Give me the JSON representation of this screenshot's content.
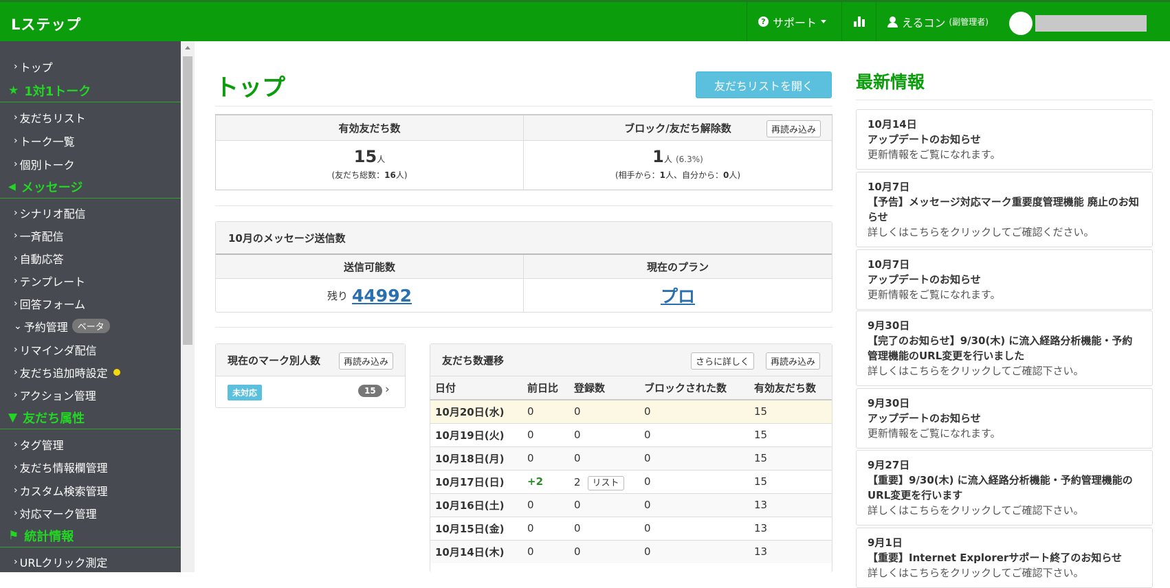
{
  "brand": "Lステップ",
  "topnav": {
    "support": "サポート",
    "user_name": "えるコン",
    "user_role": "(副管理者)"
  },
  "sidebar": {
    "items": [
      {
        "type": "item",
        "label": "トップ"
      },
      {
        "type": "head",
        "label": "1対1トーク",
        "icon": "star-icon"
      },
      {
        "type": "item",
        "label": "友だちリスト"
      },
      {
        "type": "item",
        "label": "トーク一覧"
      },
      {
        "type": "item",
        "label": "個別トーク"
      },
      {
        "type": "head",
        "label": "メッセージ",
        "icon": "megaphone-icon"
      },
      {
        "type": "item",
        "label": "シナリオ配信"
      },
      {
        "type": "item",
        "label": "一斉配信"
      },
      {
        "type": "item",
        "label": "自動応答"
      },
      {
        "type": "item",
        "label": "テンプレート"
      },
      {
        "type": "item",
        "label": "回答フォーム"
      },
      {
        "type": "item",
        "label": "予約管理",
        "badge": "ベータ",
        "expanded": true
      },
      {
        "type": "item",
        "label": "リマインダ配信"
      },
      {
        "type": "item",
        "label": "友だち追加時設定",
        "dot": true
      },
      {
        "type": "item",
        "label": "アクション管理"
      },
      {
        "type": "head",
        "label": "友だち属性",
        "icon": "filter-icon"
      },
      {
        "type": "item",
        "label": "タグ管理"
      },
      {
        "type": "item",
        "label": "友だち情報欄管理"
      },
      {
        "type": "item",
        "label": "カスタム検索管理"
      },
      {
        "type": "item",
        "label": "対応マーク管理"
      },
      {
        "type": "head",
        "label": "統計情報",
        "icon": "flag-icon"
      },
      {
        "type": "item",
        "label": "URLクリック測定"
      }
    ]
  },
  "page_title": "トップ",
  "open_friend_list": "友だちリストを開く",
  "friends": {
    "valid_label": "有効友だち数",
    "valid_count": "15",
    "unit": "人",
    "total_label": "(友だち総数：",
    "total_count": "16",
    "total_close": "人)",
    "block_label": "ブロック/友だち解除数",
    "reload": "再読み込み",
    "block_count": "1",
    "block_pct": "(6.3%)",
    "detail_a": "(相手から：",
    "detail_from_other": "1",
    "detail_b": "人、自分から：",
    "detail_from_self": "0",
    "detail_c": "人)"
  },
  "messages": {
    "title": "10月のメッセージ送信数",
    "sendable_label": "送信可能数",
    "plan_label": "現在のプラン",
    "remain_prefix": "残り",
    "remain_value": "44992",
    "plan_value": "プロ"
  },
  "marks": {
    "title": "現在のマーク別人数",
    "reload": "再読み込み",
    "tag": "未対応",
    "count": "15"
  },
  "trend": {
    "title": "友だち数遷移",
    "more": "さらに詳しく",
    "reload": "再読み込み",
    "columns": [
      "日付",
      "前日比",
      "登録数",
      "ブロックされた数",
      "有効友だち数"
    ],
    "list_btn": "リスト",
    "rows": [
      [
        "10月20日(水)",
        "0",
        "0",
        "0",
        "15"
      ],
      [
        "10月19日(火)",
        "0",
        "0",
        "0",
        "15"
      ],
      [
        "10月18日(月)",
        "0",
        "0",
        "0",
        "15"
      ],
      [
        "10月17日(日)",
        "+2",
        "2",
        "0",
        "15"
      ],
      [
        "10月16日(土)",
        "0",
        "0",
        "0",
        "13"
      ],
      [
        "10月15日(金)",
        "0",
        "0",
        "0",
        "13"
      ],
      [
        "10月14日(木)",
        "0",
        "0",
        "0",
        "13"
      ]
    ]
  },
  "news": {
    "title": "最新情報",
    "items": [
      {
        "date": "10月14日",
        "head": "アップデートのお知らせ",
        "body": "更新情報をご覧になれます。"
      },
      {
        "date": "10月7日",
        "head": "【予告】メッセージ対応マーク重要度管理機能 廃止のお知らせ",
        "body": "詳しくはこちらをクリックしてご確認ください。"
      },
      {
        "date": "10月7日",
        "head": "アップデートのお知らせ",
        "body": "更新情報をご覧になれます。"
      },
      {
        "date": "9月30日",
        "head": "【完了のお知らせ】9/30(木) に流入経路分析機能・予約管理機能のURL変更を行いました",
        "body": "詳しくはこちらをクリックしてご確認下さい。"
      },
      {
        "date": "9月30日",
        "head": "アップデートのお知らせ",
        "body": "更新情報をご覧になれます。"
      },
      {
        "date": "9月27日",
        "head": "【重要】9/30(木) に流入経路分析機能・予約管理機能のURL変更を行います",
        "body": "詳しくはこちらをクリックしてご確認下さい。"
      },
      {
        "date": "9月1日",
        "head": "【重要】Internet Explorerサポート終了のお知らせ",
        "body": "詳しくはこちらをクリックしてご確認下さい。"
      }
    ]
  },
  "colors": {
    "brand_green": "#0c9d0c",
    "sidebar_bg": "#474a51",
    "accent_blue": "#5bc0de",
    "link_blue": "#2a6fb0"
  }
}
